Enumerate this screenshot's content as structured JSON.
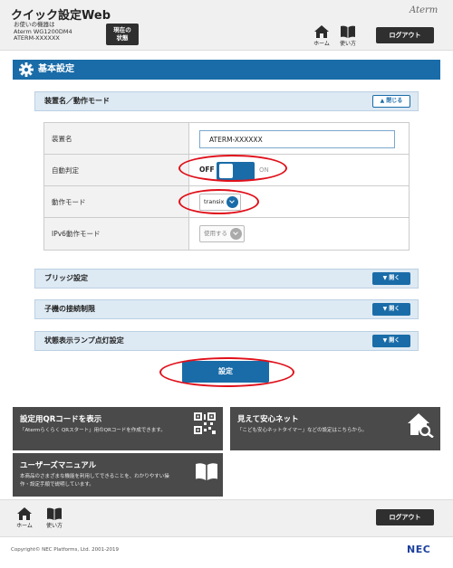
{
  "header": {
    "app_title": "クイック設定Web",
    "device_info": [
      "お使いの機器は",
      "Aterm WG1200DM4",
      "ATERM-XXXXXX"
    ],
    "status_button": [
      "現在の",
      "状態"
    ],
    "brand": "Aterm",
    "nav": {
      "home": "ホーム",
      "guide": "使い方"
    },
    "logout": "ログアウト"
  },
  "section": {
    "title": "基本設定"
  },
  "panels": {
    "device_mode": {
      "title": "装置名／動作モード",
      "toggle": "閉じる"
    },
    "bridge": {
      "title": "ブリッジ設定",
      "toggle": "開く"
    },
    "child_limit": {
      "title": "子機の接続制限",
      "toggle": "開く"
    },
    "lamp": {
      "title": "状態表示ランプ点灯設定",
      "toggle": "開く"
    }
  },
  "settings": {
    "device_name": {
      "label": "装置名",
      "value": "ATERM-XXXXXX"
    },
    "auto_detect": {
      "label": "自動判定",
      "off": "OFF",
      "on": "ON",
      "state": "OFF"
    },
    "mode": {
      "label": "動作モード",
      "value": "transix"
    },
    "ipv6": {
      "label": "IPv6動作モード",
      "value": "使用する"
    }
  },
  "submit": "設定",
  "tiles": {
    "qr": {
      "title": "設定用QRコードを表示",
      "desc": [
        "「Atermらくらく QRスタート」用のQRコードを作成できます。"
      ]
    },
    "safety": {
      "title": "見えて安心ネット",
      "desc": [
        "「こども安心ネットタイマー」などの設定はこちらから。"
      ]
    },
    "manual": {
      "title": "ユーザーズマニュアル",
      "desc": [
        "本商品のさまざまな機能を利用してできることを、わかりやすい操",
        "作・設定手順で説明しています。"
      ]
    }
  },
  "footer": {
    "nav": {
      "home": "ホーム",
      "guide": "使い方"
    },
    "logout": "ログアウト",
    "copyright": "Copyright© NEC Platforms, Ltd. 2001-2019",
    "logo": "NEC"
  },
  "colors": {
    "accent": "#1a6ca8",
    "header_bg": "#f0f0f0",
    "tile_bg": "#4a4a4a",
    "highlight": "#e0101a",
    "panel_bg": "#dde9f3"
  }
}
